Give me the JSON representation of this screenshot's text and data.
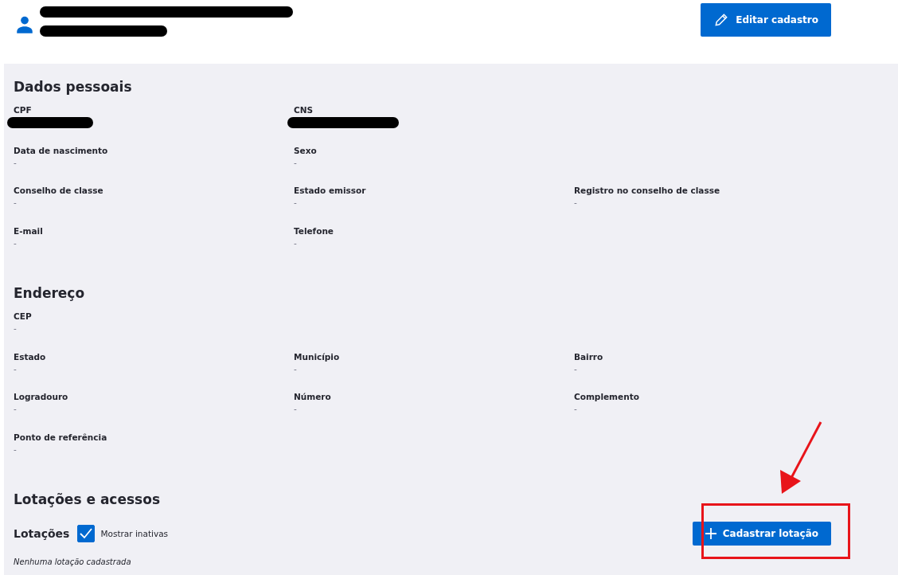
{
  "header": {
    "lines": [
      {
        "redacted": true
      },
      {
        "redacted": true
      }
    ],
    "edit_button": "Editar cadastro"
  },
  "sections": [
    {
      "title": "Dados pessoais",
      "rows": [
        [
          {
            "label": "CPF",
            "redacted": true
          },
          {
            "label": "CNS",
            "redacted": true
          }
        ],
        [
          {
            "label": "Data de nascimento",
            "value": "-"
          },
          {
            "label": "Sexo",
            "value": "-"
          }
        ],
        [
          {
            "label": "Conselho de classe",
            "value": "-"
          },
          {
            "label": "Estado emissor",
            "value": "-"
          },
          {
            "label": "Registro no conselho de classe",
            "value": "-"
          }
        ],
        [
          {
            "label": "E-mail",
            "value": "-"
          },
          {
            "label": "Telefone",
            "value": "-"
          }
        ]
      ]
    },
    {
      "title": "Endereço",
      "rows": [
        [
          {
            "label": "CEP",
            "value": "-"
          }
        ],
        [
          {
            "label": "Estado",
            "value": "-"
          },
          {
            "label": "Município",
            "value": "-"
          },
          {
            "label": "Bairro",
            "value": "-"
          }
        ],
        [
          {
            "label": "Logradouro",
            "value": "-"
          },
          {
            "label": "Número",
            "value": "-"
          },
          {
            "label": "Complemento",
            "value": "-"
          }
        ],
        [
          {
            "label": "Ponto de referência",
            "value": "-"
          }
        ]
      ]
    }
  ],
  "lotacoes": {
    "title": "Lotações e acessos",
    "subtitle": "Lotações",
    "show_inactive": {
      "label": "Mostrar inativas",
      "checked": true
    },
    "add_button": "Cadastrar lotação",
    "empty_message": "Nenhuma lotação cadastrada"
  },
  "annotations": [
    {
      "kind": "arrow_and_box"
    }
  ]
}
